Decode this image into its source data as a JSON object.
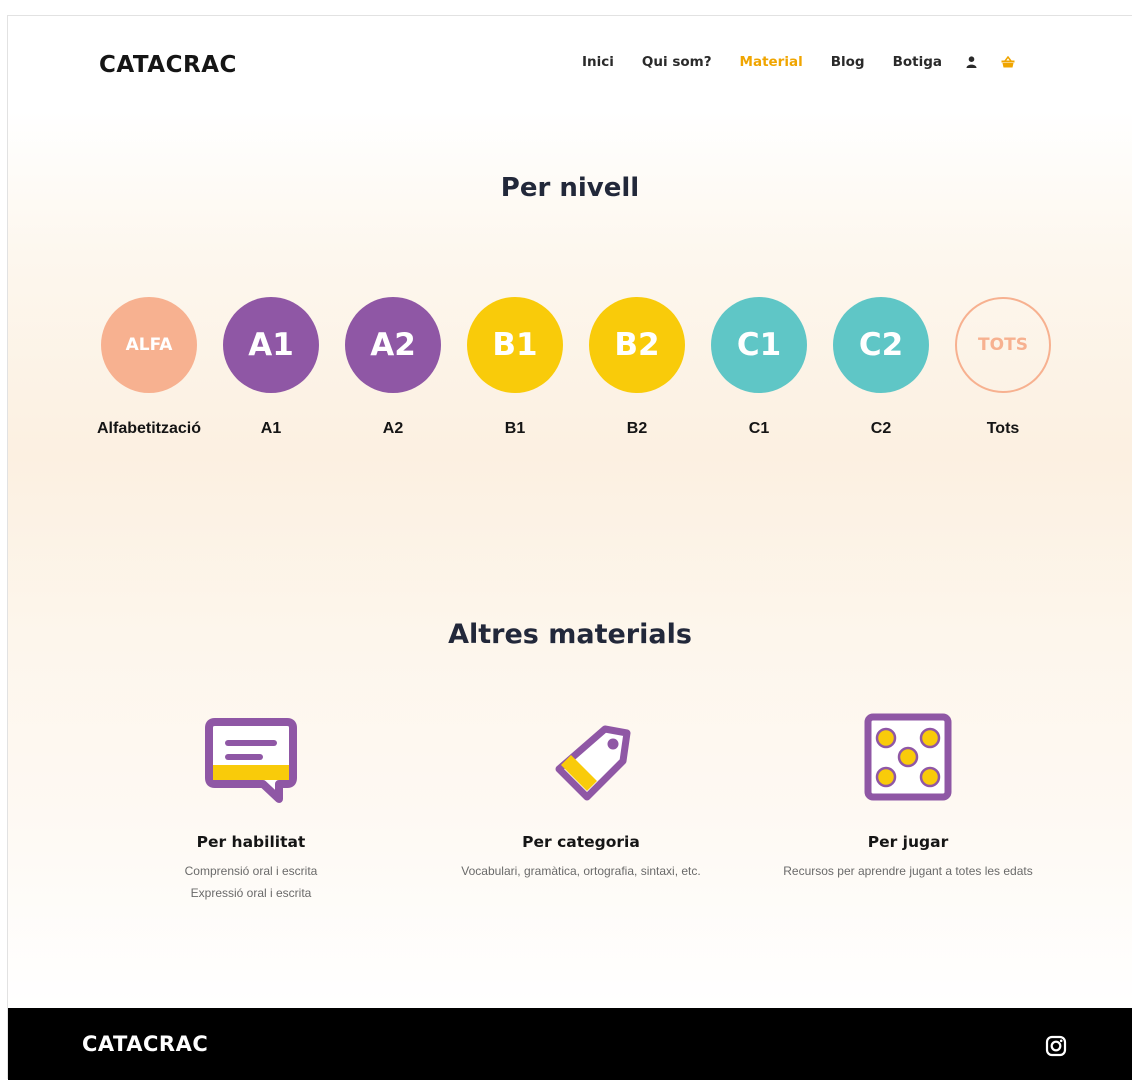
{
  "brand": {
    "logo": "CATACRAC"
  },
  "nav": {
    "items": [
      {
        "label": "Inici",
        "active": false
      },
      {
        "label": "Qui som?",
        "active": false
      },
      {
        "label": "Material",
        "active": true
      },
      {
        "label": "Blog",
        "active": false
      },
      {
        "label": "Botiga",
        "active": false
      }
    ],
    "icons": [
      "user-icon",
      "basket-icon"
    ]
  },
  "levels_section": {
    "title": "Per nivell",
    "levels": [
      {
        "badge": "ALFA",
        "label": "Alfabetització",
        "color": "#f7b190"
      },
      {
        "badge": "A1",
        "label": "A1",
        "color": "#8f57a5"
      },
      {
        "badge": "A2",
        "label": "A2",
        "color": "#8f57a5"
      },
      {
        "badge": "B1",
        "label": "B1",
        "color": "#f9cb0a"
      },
      {
        "badge": "B2",
        "label": "B2",
        "color": "#f9cb0a"
      },
      {
        "badge": "C1",
        "label": "C1",
        "color": "#5fc6c6"
      },
      {
        "badge": "C2",
        "label": "C2",
        "color": "#5fc6c6"
      },
      {
        "badge": "TOTS",
        "label": "Tots",
        "color": "#f7b190"
      }
    ]
  },
  "materials_section": {
    "title": "Altres materials",
    "items": [
      {
        "icon": "speech-bubble-icon",
        "title": "Per habilitat",
        "desc": [
          "Comprensió oral i escrita",
          "Expressió oral i escrita"
        ]
      },
      {
        "icon": "tag-icon",
        "title": "Per categoria",
        "desc": [
          "Vocabulari, gramàtica, ortografia, sintaxi, etc."
        ]
      },
      {
        "icon": "dice-icon",
        "title": "Per jugar",
        "desc": [
          "Recursos per aprendre jugant a totes les edats"
        ]
      }
    ]
  },
  "footer": {
    "logo": "CATACRAC",
    "icons": [
      "instagram-icon"
    ]
  },
  "colors": {
    "accent": "#f0a500",
    "purple": "#8f57a5",
    "yellow": "#f9cb0a",
    "teal": "#5fc6c6",
    "peach": "#f7b190"
  }
}
